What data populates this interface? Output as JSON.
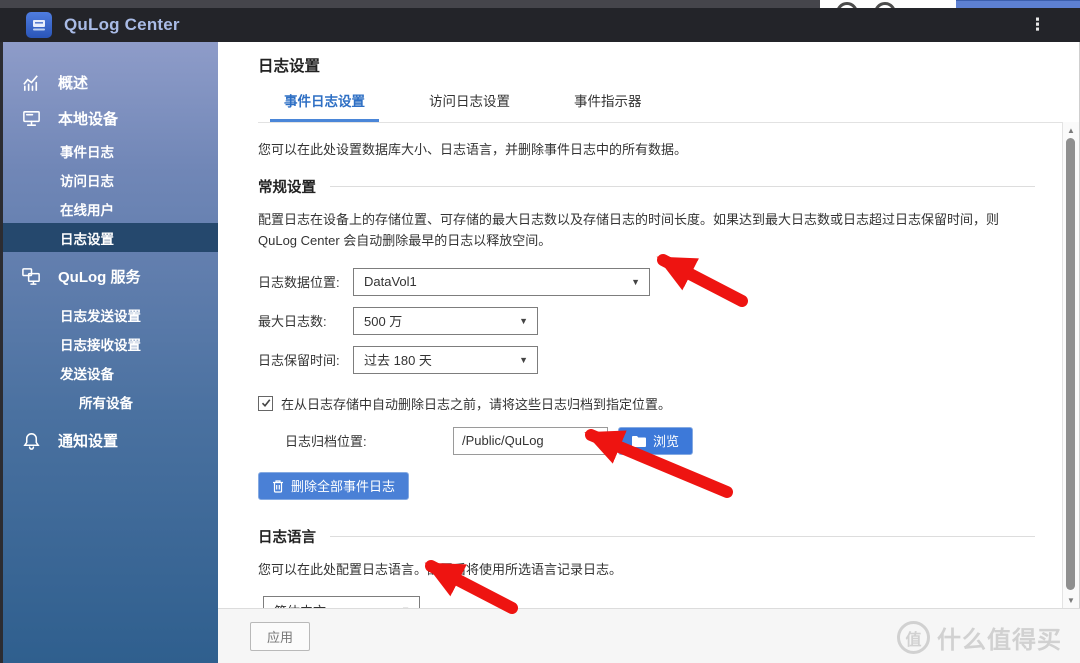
{
  "header": {
    "app_title": "QuLog Center"
  },
  "sidebar": {
    "items": [
      {
        "label": "概述",
        "icon": "overview-chart",
        "level": 1
      },
      {
        "label": "本地设备",
        "icon": "local-device",
        "level": 1
      },
      {
        "label": "事件日志",
        "level": 2
      },
      {
        "label": "访问日志",
        "level": 2
      },
      {
        "label": "在线用户",
        "level": 2
      },
      {
        "label": "日志设置",
        "level": 2,
        "selected": true
      },
      {
        "label": "QuLog 服务",
        "icon": "qulog-service",
        "level": 1
      },
      {
        "label": "日志发送设置",
        "level": 2
      },
      {
        "label": "日志接收设置",
        "level": 2
      },
      {
        "label": "发送设备",
        "level": 2
      },
      {
        "label": "所有设备",
        "level": 3
      },
      {
        "label": "通知设置",
        "icon": "notification-bell",
        "level": 1
      }
    ]
  },
  "main": {
    "title": "日志设置",
    "tabs": [
      {
        "label": "事件日志设置",
        "active": true
      },
      {
        "label": "访问日志设置",
        "active": false
      },
      {
        "label": "事件指示器",
        "active": false
      }
    ],
    "intro": "您可以在此处设置数据库大小、日志语言，并删除事件日志中的所有数据。",
    "general": {
      "heading": "常规设置",
      "description": "配置日志在设备上的存储位置、可存储的最大日志数以及存储日志的时间长度。如果达到最大日志数或日志超过日志保留时间，则 QuLog Center 会自动删除最早的日志以释放空间。",
      "fields": [
        {
          "label": "日志数据位置:",
          "value": "DataVol1"
        },
        {
          "label": "最大日志数:",
          "value": "500 万"
        },
        {
          "label": "日志保留时间:",
          "value": "过去 180 天"
        }
      ],
      "archive_checkbox_label": "在从日志存储中自动删除日志之前，请将这些日志归档到指定位置。",
      "archive_checkbox_checked": true,
      "archive_location_label": "日志归档位置:",
      "archive_path": "/Public/QuLog",
      "browse_button": "浏览",
      "delete_button": "删除全部事件日志"
    },
    "language": {
      "heading": "日志语言",
      "description": "您可以在此处配置日志语言。配置后将使用所选语言记录日志。",
      "selected": "简体中文"
    },
    "footer": {
      "apply_button": "应用"
    }
  },
  "watermark": {
    "badge": "值",
    "text": "什么值得买"
  },
  "colors": {
    "accent_blue": "#2e6fc4",
    "button_blue": "#3f7bd8",
    "sidebar_selected": "#25486d",
    "annotation_red": "#ee1411",
    "header_bg": "#232429"
  }
}
